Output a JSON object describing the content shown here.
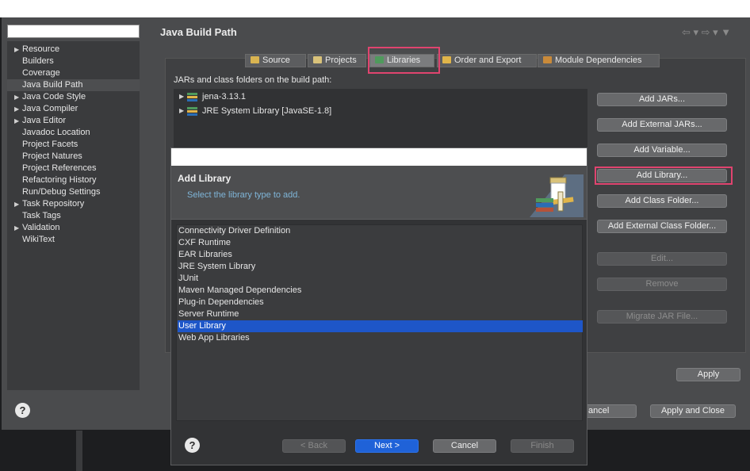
{
  "page_title": "Java Build Path",
  "nav_arrows": "⇦ ▾  ⇨ ▾  ▼",
  "sidebar": {
    "items": [
      {
        "label": "Resource",
        "arrow": "▶"
      },
      {
        "label": "Builders",
        "arrow": ""
      },
      {
        "label": "Coverage",
        "arrow": ""
      },
      {
        "label": "Java Build Path",
        "arrow": "",
        "selected": true
      },
      {
        "label": "Java Code Style",
        "arrow": "▶"
      },
      {
        "label": "Java Compiler",
        "arrow": "▶"
      },
      {
        "label": "Java Editor",
        "arrow": "▶"
      },
      {
        "label": "Javadoc Location",
        "arrow": ""
      },
      {
        "label": "Project Facets",
        "arrow": ""
      },
      {
        "label": "Project Natures",
        "arrow": ""
      },
      {
        "label": "Project References",
        "arrow": ""
      },
      {
        "label": "Refactoring History",
        "arrow": ""
      },
      {
        "label": "Run/Debug Settings",
        "arrow": ""
      },
      {
        "label": "Task Repository",
        "arrow": "▶"
      },
      {
        "label": "Task Tags",
        "arrow": ""
      },
      {
        "label": "Validation",
        "arrow": "▶"
      },
      {
        "label": "WikiText",
        "arrow": ""
      }
    ]
  },
  "tabs": [
    {
      "label": "Source",
      "icon": "source-icon",
      "color": "#d9b451"
    },
    {
      "label": "Projects",
      "icon": "projects-folder-icon",
      "color": "#d9c27a"
    },
    {
      "label": "Libraries",
      "icon": "libraries-icon",
      "color": "#4f9a5c",
      "selected": true
    },
    {
      "label": "Order and Export",
      "icon": "order-export-icon",
      "color": "#e0b54a"
    },
    {
      "label": "Module Dependencies",
      "icon": "module-dependencies-icon",
      "color": "#c98a3a"
    }
  ],
  "jars_label": "JARs and class folders on the build path:",
  "build_path_entries": [
    {
      "label": "jena-3.13.1",
      "icon": "library-icon"
    },
    {
      "label": "JRE System Library [JavaSE-1.8]",
      "icon": "library-icon"
    }
  ],
  "right_buttons": [
    {
      "label": "Add JARs...",
      "enabled": true
    },
    {
      "label": "Add External JARs...",
      "enabled": true
    },
    {
      "label": "Add Variable...",
      "enabled": true
    },
    {
      "label": "Add Library...",
      "enabled": true,
      "highlighted": true
    },
    {
      "label": "Add Class Folder...",
      "enabled": true
    },
    {
      "label": "Add External Class Folder...",
      "enabled": true
    },
    {
      "label": "Edit...",
      "enabled": false
    },
    {
      "label": "Remove",
      "enabled": false
    },
    {
      "label": "Migrate JAR File...",
      "enabled": false
    }
  ],
  "apply_label": "Apply",
  "cancel_label": "Cancel",
  "cancel_visible": "ancel",
  "apply_close_label": "Apply and Close",
  "help_icon": "?",
  "highlight_color": "#e0446f",
  "dialog": {
    "title": "Add Library",
    "subtitle": "Select the library type to add.",
    "items": [
      {
        "label": "Connectivity Driver Definition"
      },
      {
        "label": "CXF Runtime"
      },
      {
        "label": "EAR Libraries"
      },
      {
        "label": "JRE System Library"
      },
      {
        "label": "JUnit"
      },
      {
        "label": "Maven Managed Dependencies"
      },
      {
        "label": "Plug-in Dependencies"
      },
      {
        "label": "Server Runtime"
      },
      {
        "label": "User Library",
        "selected": true
      },
      {
        "label": "Web App Libraries"
      }
    ],
    "back_label": "< Back",
    "next_label": "Next >",
    "cancel_label": "Cancel",
    "finish_label": "Finish",
    "selection_color": "#1e56c8"
  }
}
